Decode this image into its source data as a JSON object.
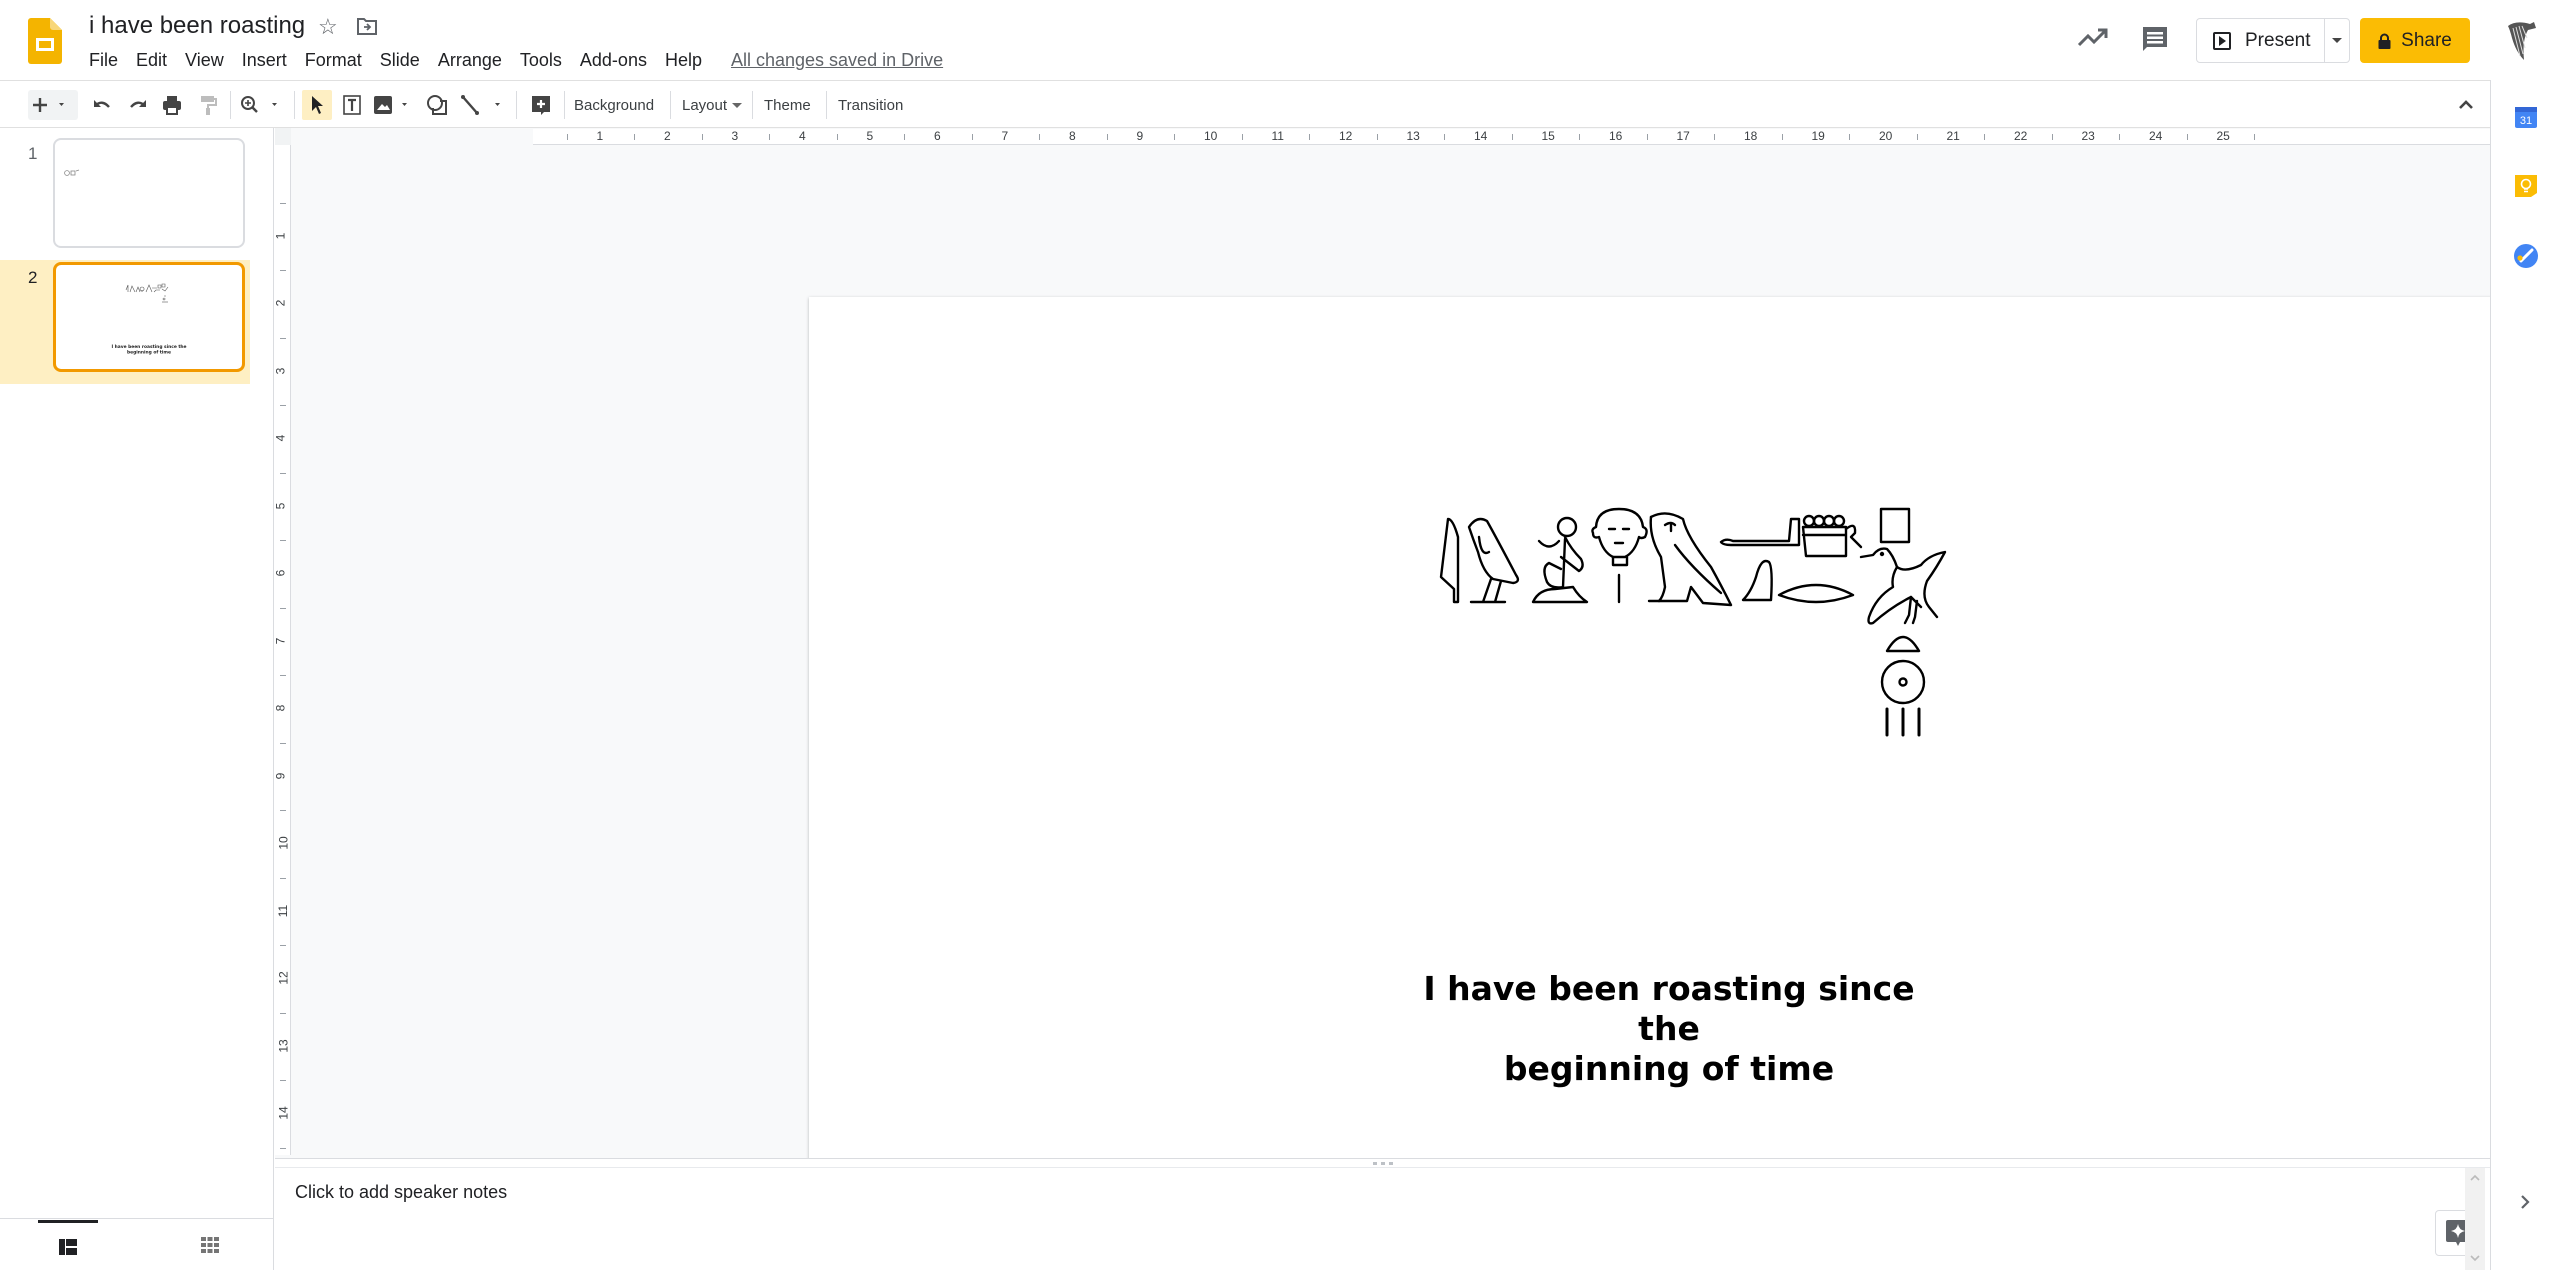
{
  "header": {
    "doc_title": "i have been roasting",
    "menu": [
      "File",
      "Edit",
      "View",
      "Insert",
      "Format",
      "Slide",
      "Arrange",
      "Tools",
      "Add-ons",
      "Help"
    ],
    "saved_status": "All changes saved in Drive",
    "present_label": "Present",
    "share_label": "Share"
  },
  "toolbar": {
    "background_label": "Background",
    "layout_label": "Layout",
    "theme_label": "Theme",
    "transition_label": "Transition"
  },
  "filmstrip": {
    "slides": [
      {
        "number": "1",
        "selected": false
      },
      {
        "number": "2",
        "selected": true,
        "caption": "I have been roasting since the beginning of time"
      }
    ]
  },
  "rulers": {
    "horizontal": [
      "1",
      "2",
      "3",
      "4",
      "5",
      "6",
      "7",
      "8",
      "9",
      "10",
      "11",
      "12",
      "13",
      "14",
      "15",
      "16",
      "17",
      "18",
      "19",
      "20",
      "21",
      "22",
      "23",
      "24",
      "25"
    ],
    "vertical": [
      "1",
      "2",
      "3",
      "4",
      "5",
      "6",
      "7",
      "8",
      "9",
      "10",
      "11",
      "12",
      "13",
      "14"
    ]
  },
  "slide": {
    "hieroglyph_text": "𓇋𓄿𓀁𓁶𓏤𓅓𓂋𓎛𓏏𓐍𓃀𓊪𓏲𓅭𓈖𓏏𓇳𓏥",
    "caption_line1": "I have been roasting since the",
    "caption_line2": "beginning of time"
  },
  "notes": {
    "placeholder": "Click to add speaker notes"
  },
  "colors": {
    "accent_yellow": "#fbbc04",
    "selected_slide_border": "#f29900",
    "selected_row_bg": "#feefc3"
  }
}
